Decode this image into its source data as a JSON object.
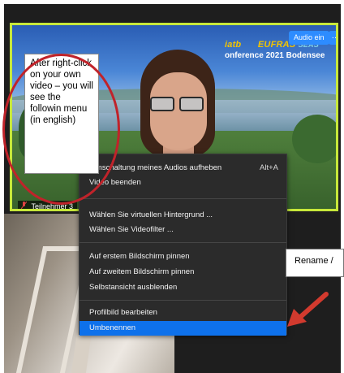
{
  "video": {
    "audio_button": "Audio ein",
    "more_button": "…",
    "participant_name": "Teilnehmer 3",
    "conference_logo_line1_prefix": "iatb",
    "conference_logo_line1": "EUFRAS",
    "conference_logo_line1_suffix": "SEAS",
    "conference_logo_line2": "onference 2021 Bodensee"
  },
  "menu": {
    "items": [
      {
        "label": "mmschaltung meines Audios aufheben",
        "shortcut": "Alt+A"
      },
      {
        "label": "Video beenden"
      },
      {
        "label": "Wählen Sie virtuellen Hintergrund ..."
      },
      {
        "label": "Wählen Sie Videofilter ..."
      },
      {
        "label": "Auf erstem Bildschirm pinnen"
      },
      {
        "label": "Auf zweitem Bildschirm pinnen"
      },
      {
        "label": "Selbstansicht ausblenden"
      },
      {
        "label": "Profilbild bearbeiten"
      },
      {
        "label": "Umbenennen",
        "active": true
      }
    ]
  },
  "annotations": {
    "note_text": "After right-click on your own video – you will see the followin menu (in english)",
    "rename_label": "Rename /"
  },
  "colors": {
    "tile_border": "#c7e83a",
    "accent_blue": "#2d8cff",
    "menu_highlight": "#0e71eb",
    "annotation_red": "#c0232a"
  }
}
